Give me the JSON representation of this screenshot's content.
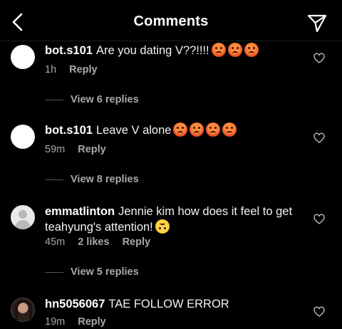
{
  "header": {
    "title": "Comments",
    "back_icon": "chevron-left-icon",
    "send_icon": "send-icon"
  },
  "comments": [
    {
      "username": "bot.s101",
      "text": "Are you dating V??!!!!",
      "emojis": [
        "angry-face",
        "angry-face",
        "angry-face"
      ],
      "time": "1h",
      "likes": "",
      "reply": "Reply",
      "view_replies": "View 6 replies",
      "avatar": "blank"
    },
    {
      "username": "bot.s101",
      "text": "Leave V alone",
      "emojis": [
        "angry-face",
        "angry-face",
        "angry-face",
        "angry-face"
      ],
      "time": "59m",
      "likes": "",
      "reply": "Reply",
      "view_replies": "View 8 replies",
      "avatar": "blank"
    },
    {
      "username": "emmatlinton",
      "text": "Jennie kim how does it feel to get teahyung's attention!",
      "emojis": [
        "upside-down-face"
      ],
      "time": "45m",
      "likes": "2 likes",
      "reply": "Reply",
      "view_replies": "View 5 replies",
      "avatar": "default"
    },
    {
      "username": "hn5056067",
      "text": "TAE FOLLOW ERROR",
      "emojis": [],
      "time": "19m",
      "likes": "",
      "reply": "Reply",
      "view_replies": "",
      "avatar": "photo"
    }
  ]
}
